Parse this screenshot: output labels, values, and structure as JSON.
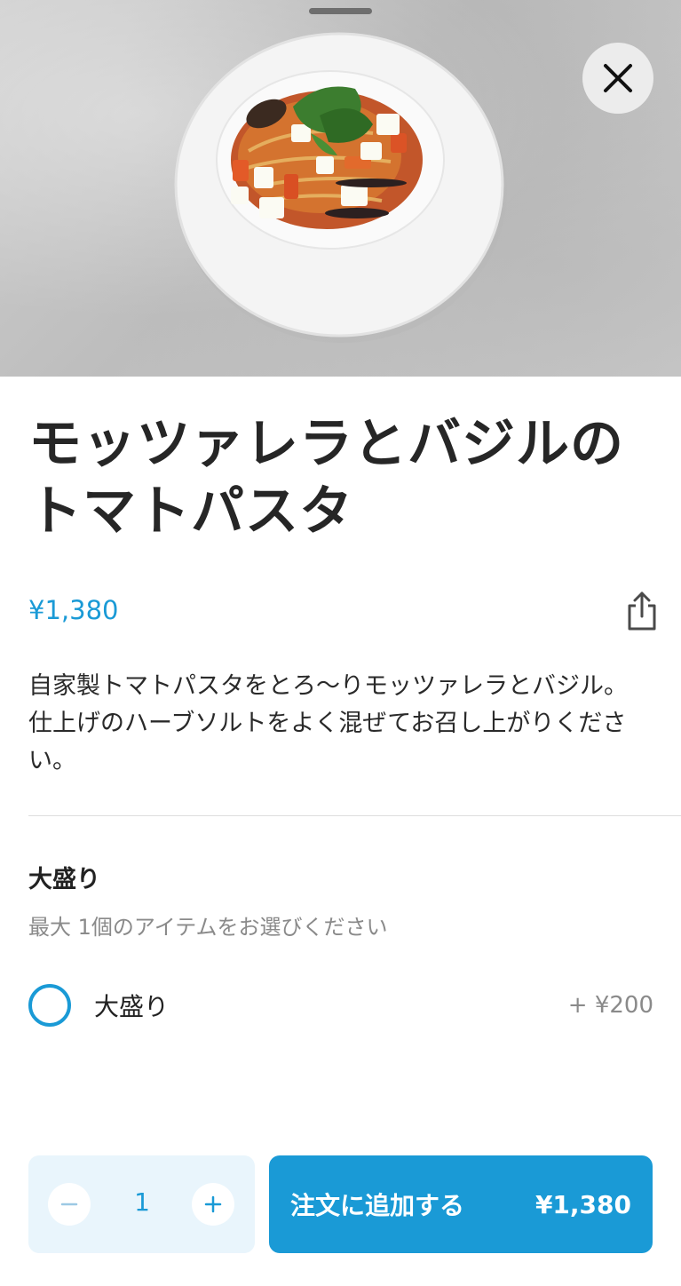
{
  "item": {
    "title": "モッツァレラとバジルのトマトパスタ",
    "price": "¥1,380",
    "description": "自家製トマトパスタをとろ〜りモッツァレラとバジル。仕上げのハーブソルトをよく混ぜてお召し上がりください。"
  },
  "icons": {
    "close": "close-icon",
    "share": "share-icon",
    "minus": "minus-icon",
    "plus": "plus-icon"
  },
  "options": {
    "group_title": "大盛り",
    "group_subtitle": "最大 1個のアイテムをお選びください",
    "items": [
      {
        "label": "大盛り",
        "price": "+ ¥200",
        "selected": false
      }
    ]
  },
  "cart": {
    "quantity": "1",
    "add_label": "注文に追加する",
    "add_price": "¥1,380"
  },
  "colors": {
    "accent": "#1a9ad6",
    "stepper_bg": "#e9f5fc"
  }
}
